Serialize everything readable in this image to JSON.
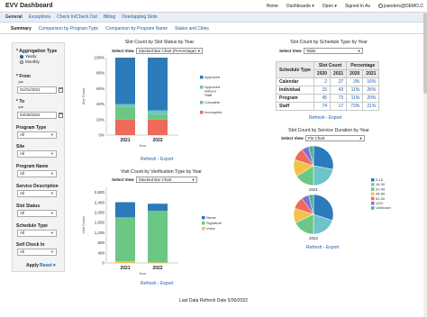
{
  "app": {
    "title": "EVV Dashboard",
    "top_links": [
      "Home",
      "Dashboards ▾",
      "Open ▾",
      "Signed In As",
      "jsanders@DEMO.C"
    ]
  },
  "nav": [
    "General",
    "Exceptions",
    "Check In/Check Out",
    "Billing",
    "Overlapping Slots"
  ],
  "tabs": [
    "Summary",
    "Comparison by Program Type",
    "Comparison by Program Name",
    "States and Cities"
  ],
  "filters": {
    "aggregation_label": "* Aggregation Type",
    "aggregation_options": [
      "Yearly",
      "Monthly"
    ],
    "from_label": "* From",
    "from_op": ">=",
    "from_value": "01/01/2021",
    "to_label": "* To",
    "to_op": "<=",
    "to_value": "04/30/2022",
    "program_type_label": "Program Type",
    "site_label": "Site",
    "program_name_label": "Program Name",
    "service_description_label": "Service Description",
    "slot_status_label": "Slot Status",
    "schedule_type_label": "Schedule Type",
    "self_check_in_label": "Self Check In",
    "all": "All",
    "apply_label": "Apply",
    "reset_label": "Reset ▾"
  },
  "colors": {
    "approved": "#2b7bba",
    "approved_without_staff": "#6ec3c9",
    "complete": "#6cc784",
    "incomplete": "#ee6a5a",
    "nurse": "#2b7bba",
    "signature": "#6cc784",
    "voice": "#f3c24a",
    "pie": [
      "#2b7bba",
      "#6ec3c9",
      "#6cc784",
      "#f3c24a",
      "#ee6a5a",
      "#8a6fc9",
      "#3fb5a3"
    ]
  },
  "chart1": {
    "title": "Slot Count by Slot Status by Year",
    "select_label": "Select View",
    "select_value": "Stacked Bar Chart (Percentage)",
    "y_axis_label": "Slot Count",
    "x_axis_label": "Year",
    "refresh_label": "Refresh - Export"
  },
  "chart2": {
    "title": "Slot Count by Schedule Type by Year",
    "select_label": "Select View",
    "select_value": "Table",
    "table": {
      "headers": [
        "Schedule Type",
        "Slot Count",
        "Percentage"
      ],
      "years": [
        "2020",
        "2021",
        "2020",
        "2021"
      ],
      "rows": [
        {
          "label": "Calendar",
          "values": [
            "2",
            "27",
            "3%",
            "16%"
          ]
        },
        {
          "label": "Individual",
          "values": [
            "15",
            "43",
            "11%",
            "26%"
          ]
        },
        {
          "label": "Program",
          "values": [
            "45",
            "73",
            "11%",
            "20%"
          ]
        },
        {
          "label": "Staff",
          "values": [
            "74",
            "17",
            "73%",
            "21%"
          ]
        }
      ]
    },
    "refresh_label": "Refresh - Export"
  },
  "chart3": {
    "title": "Visit Count by Verification Type by Year",
    "select_label": "Select View",
    "select_value": "Stacked Bar Chart",
    "y_axis_label": "Visit Count",
    "x_axis_label": "Year",
    "refresh_label": "Refresh - Export"
  },
  "chart4": {
    "title": "Slot Count by Service Duration by Year",
    "select_label": "Select View",
    "select_value": "Pie Chart",
    "pie_labels": [
      "2021",
      "2022"
    ],
    "legend": [
      "0-15",
      "16-30",
      "31-45",
      "46-60",
      "61-90",
      "120+",
      "Unknown"
    ],
    "refresh_label": "Refresh - Export"
  },
  "chart_data": [
    {
      "type": "bar",
      "title": "Slot Count by Slot Status by Year",
      "xlabel": "Year",
      "ylabel": "Slot Count",
      "categories": [
        "2021",
        "2022"
      ],
      "ylim": [
        0,
        100
      ],
      "y_ticks": [
        "0%",
        "20%",
        "40%",
        "60%",
        "80%",
        "100%"
      ],
      "stacked": true,
      "series": [
        {
          "name": "Incomplete",
          "values": [
            20,
            20
          ]
        },
        {
          "name": "Complete",
          "values": [
            17,
            7
          ]
        },
        {
          "name": "Approved without Staff",
          "values": [
            3,
            5
          ]
        },
        {
          "name": "Approved",
          "values": [
            60,
            68
          ]
        }
      ]
    },
    {
      "type": "table",
      "title": "Slot Count by Schedule Type by Year",
      "columns": [
        "Schedule Type",
        "Slot Count 2020",
        "Slot Count 2021",
        "Percentage 2020",
        "Percentage 2021"
      ],
      "rows": [
        [
          "Calendar",
          2,
          27,
          "3%",
          "16%"
        ],
        [
          "Individual",
          15,
          43,
          "11%",
          "26%"
        ],
        [
          "Program",
          45,
          73,
          "11%",
          "20%"
        ],
        [
          "Staff",
          74,
          17,
          "73%",
          "21%"
        ]
      ]
    },
    {
      "type": "bar",
      "title": "Visit Count by Verification Type by Year",
      "xlabel": "Year",
      "ylabel": "Visit Count",
      "categories": [
        "2021",
        "2022"
      ],
      "ylim": [
        0,
        3000
      ],
      "y_ticks": [
        "0",
        "400",
        "800",
        "1,200",
        "1,600",
        "2,000",
        "2,400",
        "2,800"
      ],
      "stacked": true,
      "series": [
        {
          "name": "Voice",
          "values": [
            60,
            20
          ]
        },
        {
          "name": "Signature",
          "values": [
            1750,
            2050
          ]
        },
        {
          "name": "Nurse",
          "values": [
            600,
            280
          ]
        }
      ]
    },
    {
      "type": "pie",
      "title": "Slot Count by Service Duration by Year",
      "series": [
        {
          "name": "2021",
          "labels": [
            "0-15",
            "16-30",
            "31-45",
            "46-60",
            "61-90",
            "120+",
            "Unknown"
          ],
          "values": [
            28,
            22,
            16,
            14,
            10,
            6,
            4
          ]
        },
        {
          "name": "2022",
          "labels": [
            "0-15",
            "16-30",
            "31-45",
            "46-60",
            "61-90",
            "120+",
            "Unknown"
          ],
          "values": [
            30,
            20,
            18,
            12,
            10,
            6,
            4
          ]
        }
      ]
    }
  ],
  "footer": {
    "last_refresh": "Last Data Refresh Date 5/30/2022"
  }
}
